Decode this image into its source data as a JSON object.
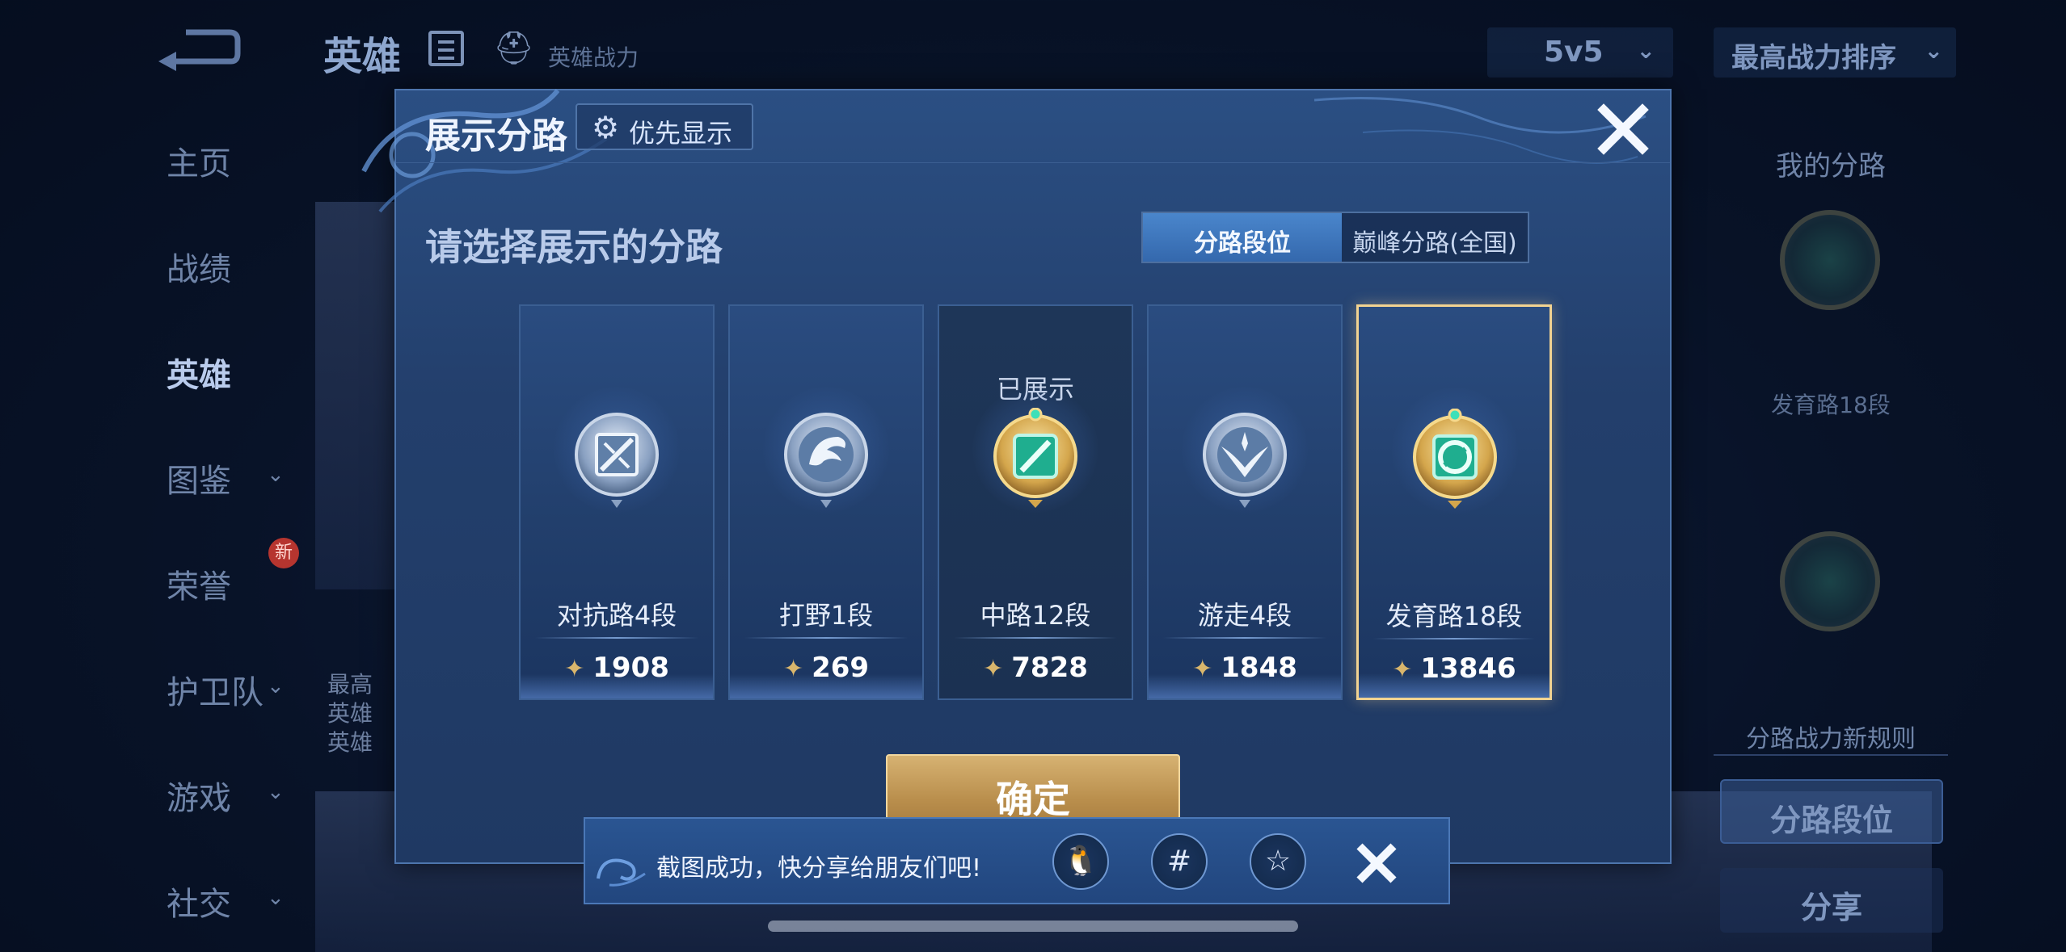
{
  "topbar": {
    "title": "英雄",
    "subtitle": "英雄战力",
    "mode_select": "5v5",
    "sort_select": "最高战力排序"
  },
  "leftnav": {
    "items": [
      {
        "label": "主页"
      },
      {
        "label": "战绩"
      },
      {
        "label": "英雄"
      },
      {
        "label": "图鉴"
      },
      {
        "label": "荣誉",
        "badge": "新"
      },
      {
        "label": "护卫队"
      },
      {
        "label": "游戏"
      },
      {
        "label": "社交"
      }
    ]
  },
  "background_card": {
    "line1": "最高",
    "line2": "英雄",
    "line3": "英雄"
  },
  "right_panel": {
    "title": "我的分路",
    "badge_label": "发育路18段",
    "rule_link": "分路战力新规则",
    "primary_button": "分路段位",
    "share_button": "分享"
  },
  "modal": {
    "title": "展示分路",
    "priority_button": "优先显示",
    "prompt": "请选择展示的分路",
    "tabs": [
      {
        "label": "分路段位",
        "active": true
      },
      {
        "label": "巅峰分路(全国)",
        "active": false
      }
    ],
    "lanes": [
      {
        "name": "对抗路4段",
        "power": "1908",
        "icon": "clash-lane-emblem-icon",
        "shown": false,
        "selected": false
      },
      {
        "name": "打野1段",
        "power": "269",
        "icon": "jungle-emblem-icon",
        "shown": false,
        "selected": false
      },
      {
        "name": "中路12段",
        "power": "7828",
        "icon": "mid-lane-emblem-icon",
        "shown": true,
        "selected": false,
        "shown_label": "已展示"
      },
      {
        "name": "游走4段",
        "power": "1848",
        "icon": "roam-emblem-icon",
        "shown": false,
        "selected": false
      },
      {
        "name": "发育路18段",
        "power": "13846",
        "icon": "farm-lane-emblem-icon",
        "shown": false,
        "selected": true
      }
    ],
    "confirm_button": "确定"
  },
  "toast": {
    "message": "截图成功，快分享给朋友们吧!",
    "icons": [
      "qq-icon",
      "wechat-moments-icon",
      "qzone-icon"
    ]
  },
  "colors": {
    "modal_bg": "#244272",
    "accent_blue": "#3f7cc4",
    "gold": "#d6b272",
    "selected_border": "#f2d391"
  }
}
